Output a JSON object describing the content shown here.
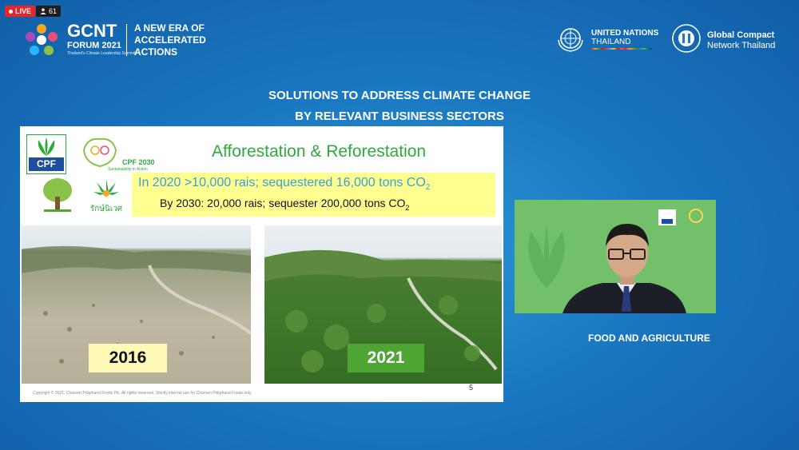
{
  "stream": {
    "live_label": "LIVE",
    "viewer_count": "61"
  },
  "event": {
    "logo_title": "GCNT",
    "logo_year": "FORUM 2021",
    "logo_subtitle": "Thailand's Climate Leadership Summit",
    "tagline": [
      "A NEW ERA OF",
      "ACCELERATED",
      "ACTIONS"
    ]
  },
  "partners": {
    "un": {
      "name": "UNITED NATIONS",
      "country": "THAILAND"
    },
    "gc": {
      "name": "Global Compact",
      "sub": "Network Thailand"
    }
  },
  "session": {
    "heading_line1": "SOLUTIONS TO ADDRESS CLIMATE CHANGE",
    "heading_line2": "BY RELEVANT BUSINESS SECTORS"
  },
  "slide": {
    "brand": "CPF",
    "sustainability_title": "CPF 2030",
    "sustainability_sub": "Sustainability in Action",
    "title": "Afforestation & Reforestation",
    "stat1": "In 2020 >10,000 rais; sequestered 16,000 tons CO",
    "stat2": "By 2030: 20,000 rais; sequester 200,000 tons CO",
    "co2_sub": "2",
    "photo_left_year": "2016",
    "photo_right_year": "2021",
    "footer": "Copyright © 2021, Charoen Pokphand Foods Plc. All rights reserved. Strictly internal use for Charoen Pokphand Foods only",
    "page_number": "5",
    "colors": {
      "title_green": "#2eaa3c",
      "stat_blue": "#3a9fd8",
      "highlight": "#ffff90",
      "year_left_bg": "#fff9b8",
      "year_right_bg": "#4ea534"
    }
  },
  "speaker": {
    "caption": "FOOD AND AGRICULTURE"
  }
}
